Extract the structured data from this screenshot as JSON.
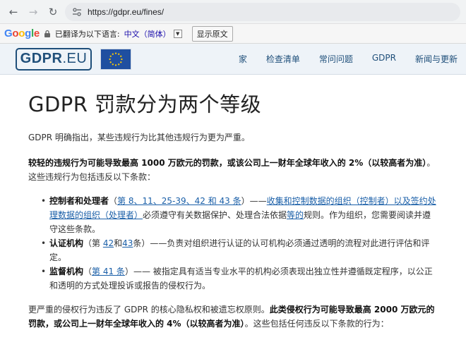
{
  "browser": {
    "url": "https://gdpr.eu/fines/"
  },
  "translate_bar": {
    "logo_letters": [
      "G",
      "o",
      "o",
      "g",
      "l",
      "e"
    ],
    "translated_label": "已翻译为以下语言:",
    "language": "中文（简体）",
    "show_original": "显示原文"
  },
  "site": {
    "logo_bold": "GDPR",
    "logo_light": ".EU",
    "nav": [
      "家",
      "检查清单",
      "常问问题",
      "GDPR",
      "新闻与更新"
    ]
  },
  "article": {
    "title": "GDPR 罚款分为两个等级",
    "intro": "GDPR 明确指出，某些违规行为比其他违规行为更为严重。",
    "lighter_bold": "较轻的违规行为可能导致最高 1000 万欧元的罚款，或该公司上一财年全球年收入的 2%（以较高者为准）",
    "lighter_rest": "。这些违规行为包括违反以下条款：",
    "bullets": {
      "b1": {
        "bold1": "控制者",
        "plain1": "和",
        "bold2": "处理者",
        "paren_open": "（",
        "link1": "第 8、11、25-39、42 和 43 条",
        "paren_close": "）——",
        "link2": "收集和控制数据的组织（控制者）以及签约处理数据的组织（处理者）",
        "plain2": "必须遵守有关数据保护、处理合法依据",
        "link3": "等的",
        "plain3": "规则。作为组织，您需要阅读并遵守这些条款。"
      },
      "b2": {
        "bold": "认证机构",
        "paren_open": "（第 ",
        "link1": "42",
        "and": "和",
        "link2": "43",
        "rest": "条）——负责对组织进行认证的认可机构必须通过透明的流程对此进行评估和评定。"
      },
      "b3": {
        "bold": "监督机构",
        "paren_open": "（",
        "link": "第 41 条",
        "rest": "）—— 被指定具有适当专业水平的机构必须表现出独立性并遵循既定程序，以公正和透明的方式处理投诉或报告的侵权行为。"
      }
    },
    "severe_plain": "更严重的侵权行为违反了 GDPR 的核心隐私权和被遗忘权原则。",
    "severe_bold": "此类侵权行为可能导致最高 2000 万欧元的罚款，或公司上一财年全球年收入的 4%（以较高者为准）",
    "severe_rest": "。这些包括任何违反以下条款的行为："
  },
  "colors": {
    "link": "#1a5fa8",
    "header_bg": "#eef3f8",
    "logo": "#1f4f7a",
    "eu_flag": "#1f4fa0"
  }
}
